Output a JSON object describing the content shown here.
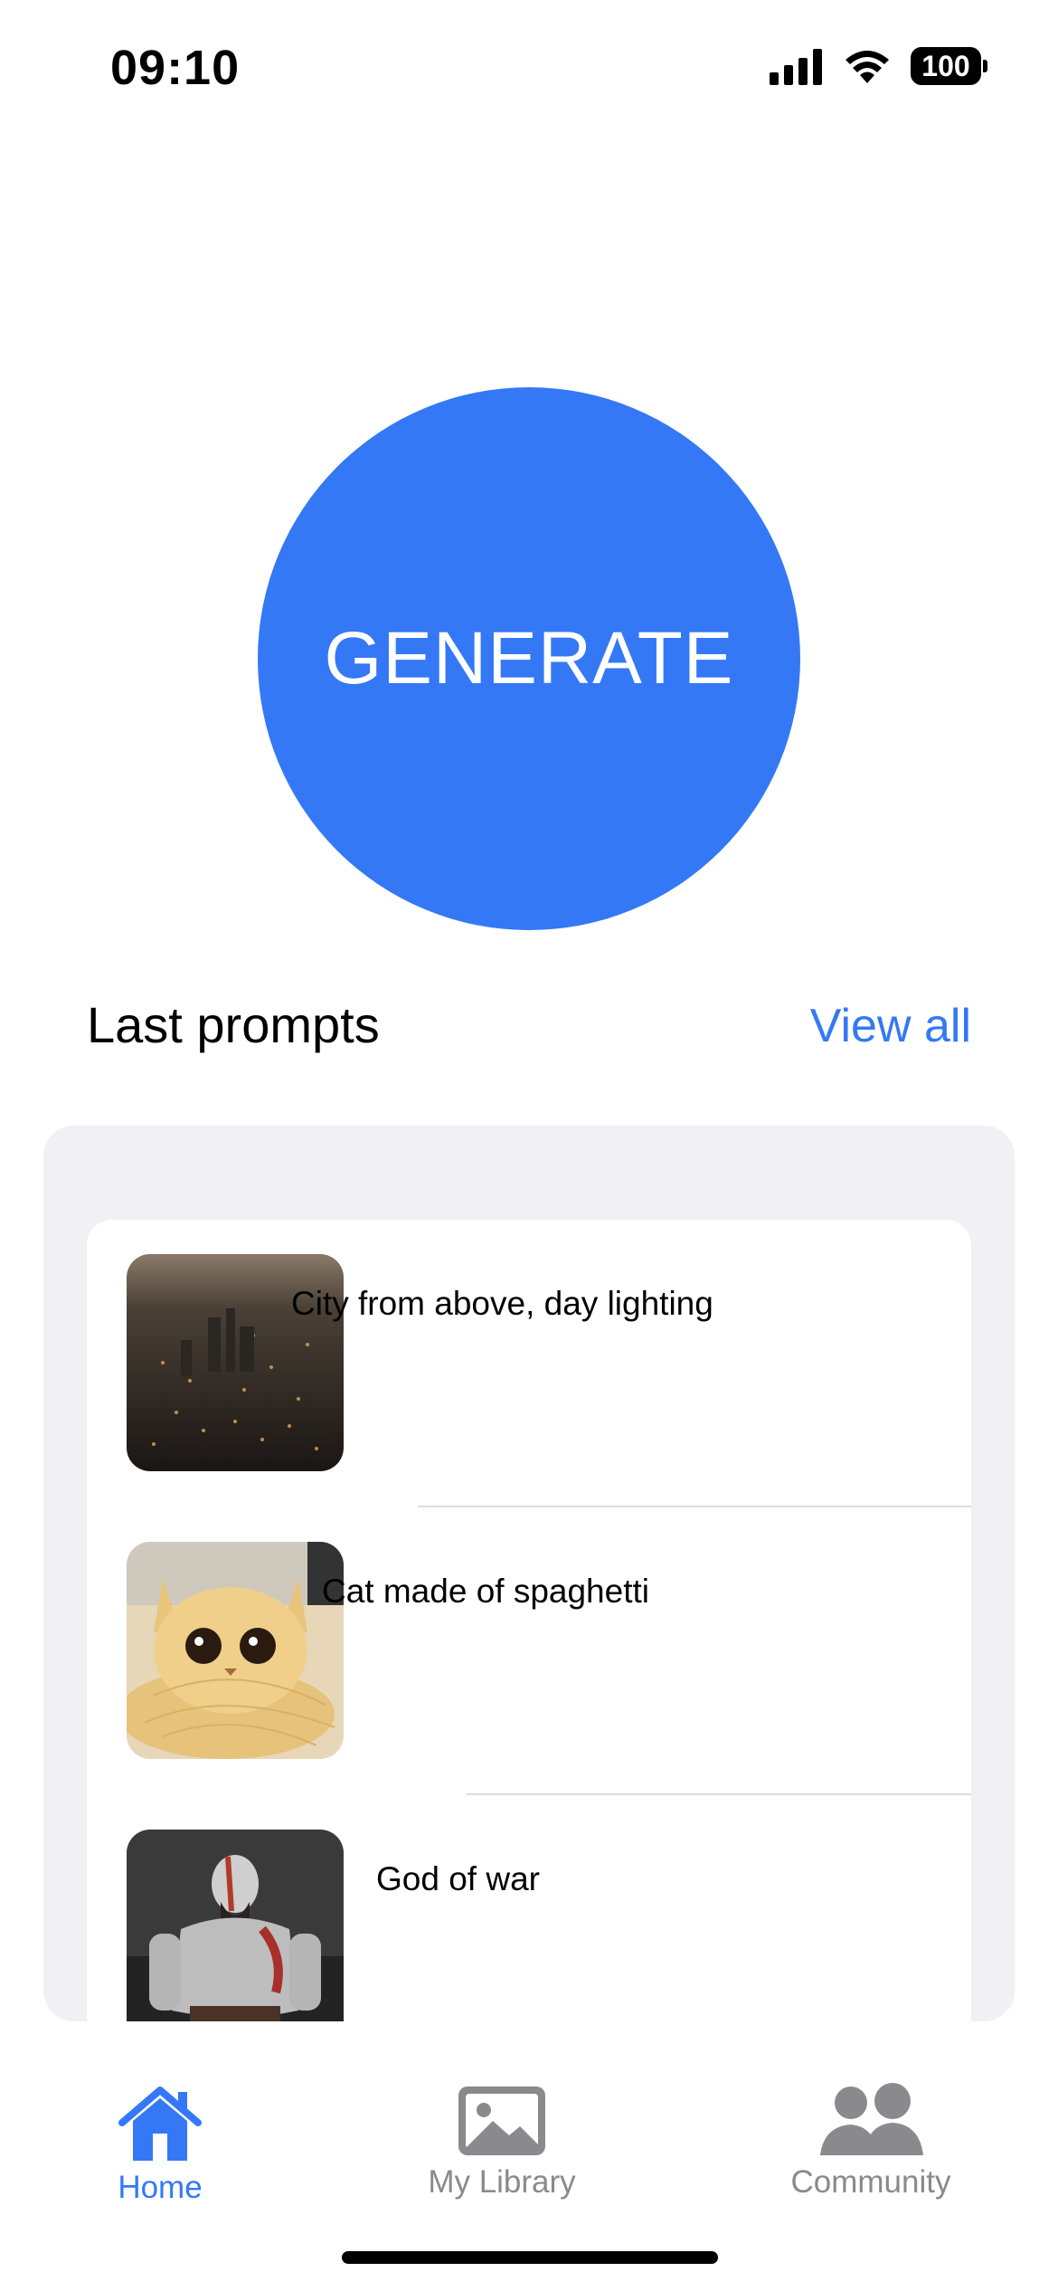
{
  "status_bar": {
    "time": "09:10",
    "battery": "100"
  },
  "generate_button": {
    "label": "GENERATE"
  },
  "last_prompts": {
    "title": "Last prompts",
    "view_all": "View all",
    "items": [
      {
        "text": "City from above, day lighting",
        "thumb_icon": "city-aerial-image"
      },
      {
        "text": "Cat made of spaghetti",
        "thumb_icon": "spaghetti-cat-image"
      },
      {
        "text": "God of war",
        "thumb_icon": "warrior-image"
      }
    ]
  },
  "tabbar": {
    "tabs": [
      {
        "label": "Home",
        "icon": "house-icon",
        "active": true
      },
      {
        "label": "My Library",
        "icon": "photo-icon",
        "active": false
      },
      {
        "label": "Community",
        "icon": "people-icon",
        "active": false
      }
    ]
  },
  "colors": {
    "accent": "#3478f6",
    "panel_bg": "#f0f0f5",
    "inactive": "#8a8a8e"
  }
}
